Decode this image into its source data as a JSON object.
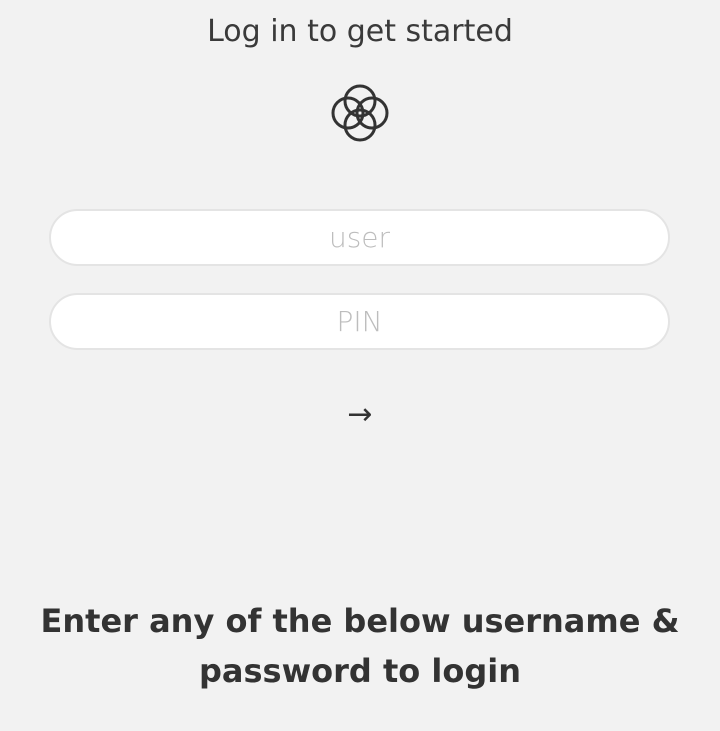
{
  "login": {
    "title": "Log in to get started",
    "logo_icon": "four-rings-logo-icon",
    "user_placeholder": "user",
    "pin_placeholder": "PIN",
    "submit_label": "→",
    "submit_icon": "arrow-right-icon",
    "hint": "Enter any of the below username & password to login"
  },
  "colors": {
    "background": "#f2f2f2",
    "text": "#333333",
    "placeholder": "#bdbdbd",
    "field_border": "#e4e4e4"
  }
}
